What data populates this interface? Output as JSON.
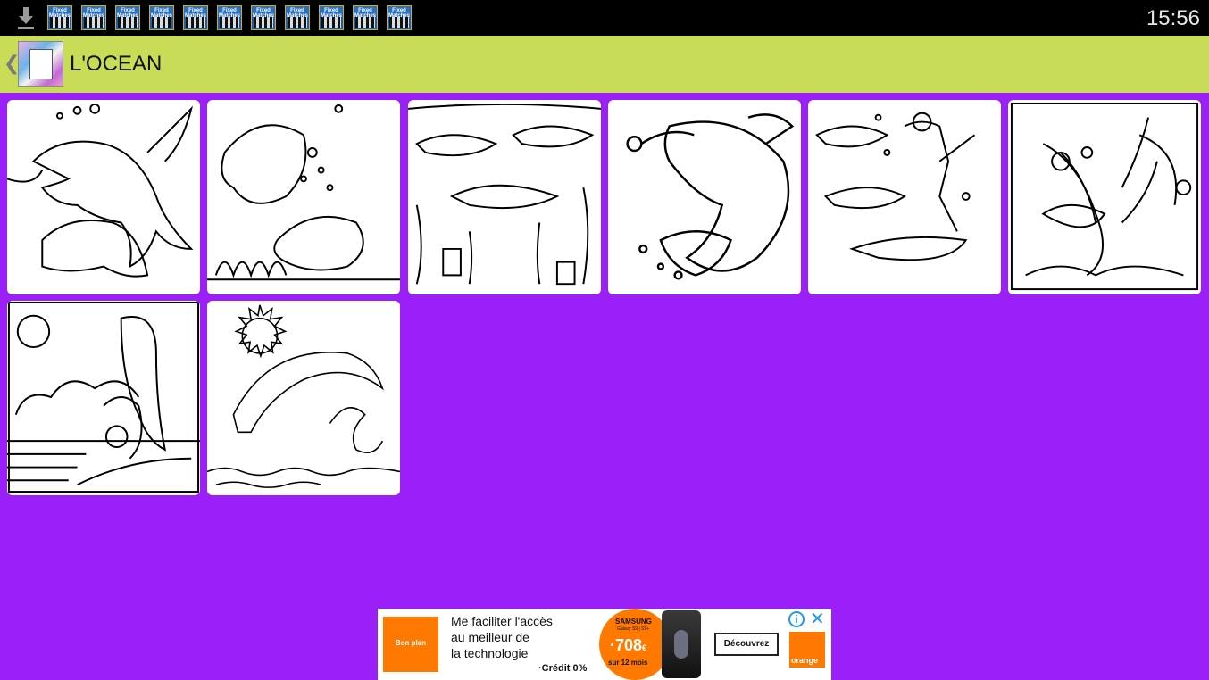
{
  "status_bar": {
    "time": "15:56",
    "notification_icon_text": "Fixed Matches",
    "notification_count": 11
  },
  "action_bar": {
    "title": "L'OCEAN"
  },
  "gallery": {
    "tiles": [
      {
        "subject": "two dolphins"
      },
      {
        "subject": "fish with hat"
      },
      {
        "subject": "dolphins school"
      },
      {
        "subject": "fish and bee"
      },
      {
        "subject": "diver and dolphins"
      },
      {
        "subject": "swordfish and crab"
      },
      {
        "subject": "dolphins with ball"
      },
      {
        "subject": "dolphin jumping sun"
      }
    ]
  },
  "ad": {
    "logo_text": "Bon plan",
    "line1": "Me faciliter l'accès",
    "line2": "au meilleur de",
    "line3": "la technologie",
    "credit": "·Crédit 0%",
    "brand": "SAMSUNG",
    "sub": "Galaxy S9 | S9+",
    "price": "·708",
    "price_suffix": "€",
    "months": "sur 12 mois",
    "cta": "Découvrez",
    "operator": "orange",
    "info_glyph": "i",
    "close_glyph": "✕",
    "accent": "#ff7900"
  },
  "colors": {
    "background": "#9b1ff7",
    "action_bar": "#c9dc58",
    "status_bar": "#000000"
  }
}
